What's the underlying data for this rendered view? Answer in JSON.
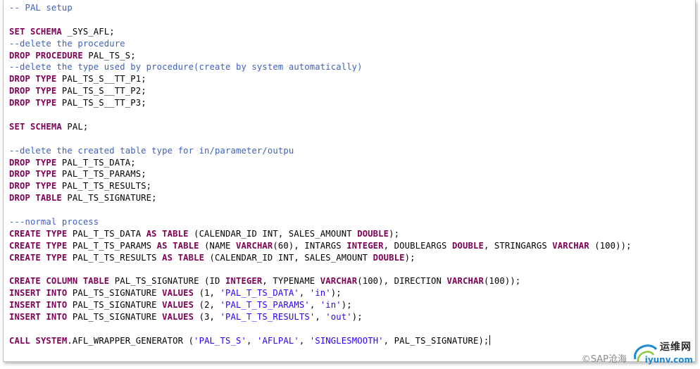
{
  "editor": {
    "lines": [
      {
        "tokens": [
          {
            "t": "-- PAL setup",
            "c": "cm"
          }
        ]
      },
      {
        "tokens": []
      },
      {
        "tokens": [
          {
            "t": "SET SCHEMA",
            "c": "kw"
          },
          {
            "t": " _SYS_AFL;",
            "c": ""
          }
        ]
      },
      {
        "tokens": [
          {
            "t": "--delete the procedure",
            "c": "cm"
          }
        ]
      },
      {
        "tokens": [
          {
            "t": "DROP PROCEDURE",
            "c": "kw"
          },
          {
            "t": " PAL_TS_S;",
            "c": ""
          }
        ]
      },
      {
        "tokens": [
          {
            "t": "--delete the type used by procedure(create by system automatically)",
            "c": "cm"
          }
        ]
      },
      {
        "tokens": [
          {
            "t": "DROP TYPE",
            "c": "kw"
          },
          {
            "t": " PAL_TS_S__TT_P1;",
            "c": ""
          }
        ]
      },
      {
        "tokens": [
          {
            "t": "DROP TYPE",
            "c": "kw"
          },
          {
            "t": " PAL_TS_S__TT_P2;",
            "c": ""
          }
        ]
      },
      {
        "tokens": [
          {
            "t": "DROP TYPE",
            "c": "kw"
          },
          {
            "t": " PAL_TS_S__TT_P3;",
            "c": ""
          }
        ]
      },
      {
        "tokens": []
      },
      {
        "tokens": [
          {
            "t": "SET SCHEMA",
            "c": "kw"
          },
          {
            "t": " PAL;",
            "c": ""
          }
        ]
      },
      {
        "tokens": []
      },
      {
        "tokens": [
          {
            "t": "--delete the created table type for in/parameter/outpu",
            "c": "cm"
          }
        ]
      },
      {
        "tokens": [
          {
            "t": "DROP TYPE",
            "c": "kw"
          },
          {
            "t": " PAL_T_TS_DATA;",
            "c": ""
          }
        ]
      },
      {
        "tokens": [
          {
            "t": "DROP TYPE",
            "c": "kw"
          },
          {
            "t": " PAL_T_TS_PARAMS;",
            "c": ""
          }
        ]
      },
      {
        "tokens": [
          {
            "t": "DROP TYPE",
            "c": "kw"
          },
          {
            "t": " PAL_T_TS_RESULTS;",
            "c": ""
          }
        ]
      },
      {
        "tokens": [
          {
            "t": "DROP TABLE",
            "c": "kw"
          },
          {
            "t": " PAL_TS_SIGNATURE;",
            "c": ""
          }
        ]
      },
      {
        "tokens": []
      },
      {
        "tokens": [
          {
            "t": "---normal process",
            "c": "cm"
          }
        ]
      },
      {
        "tokens": [
          {
            "t": "CREATE TYPE",
            "c": "kw"
          },
          {
            "t": " PAL_T_TS_DATA ",
            "c": ""
          },
          {
            "t": "AS TABLE",
            "c": "kw"
          },
          {
            "t": " (CALENDAR_ID INT, SALES_AMOUNT ",
            "c": ""
          },
          {
            "t": "DOUBLE",
            "c": "kw"
          },
          {
            "t": ");",
            "c": ""
          }
        ]
      },
      {
        "tokens": [
          {
            "t": "CREATE TYPE",
            "c": "kw"
          },
          {
            "t": " PAL_T_TS_PARAMS ",
            "c": ""
          },
          {
            "t": "AS TABLE",
            "c": "kw"
          },
          {
            "t": " (NAME ",
            "c": ""
          },
          {
            "t": "VARCHAR",
            "c": "kw"
          },
          {
            "t": "(60), INTARGS ",
            "c": ""
          },
          {
            "t": "INTEGER",
            "c": "kw"
          },
          {
            "t": ", DOUBLEARGS ",
            "c": ""
          },
          {
            "t": "DOUBLE",
            "c": "kw"
          },
          {
            "t": ", STRINGARGS ",
            "c": ""
          },
          {
            "t": "VARCHAR",
            "c": "kw"
          },
          {
            "t": " (100));",
            "c": ""
          }
        ]
      },
      {
        "tokens": [
          {
            "t": "CREATE TYPE",
            "c": "kw"
          },
          {
            "t": " PAL_T_TS_RESULTS ",
            "c": ""
          },
          {
            "t": "AS TABLE",
            "c": "kw"
          },
          {
            "t": " (CALENDAR_ID INT, SALES_AMOUNT ",
            "c": ""
          },
          {
            "t": "DOUBLE",
            "c": "kw"
          },
          {
            "t": ");",
            "c": ""
          }
        ]
      },
      {
        "tokens": []
      },
      {
        "tokens": [
          {
            "t": "CREATE COLUMN TABLE",
            "c": "kw"
          },
          {
            "t": " PAL_TS_SIGNATURE (ID ",
            "c": ""
          },
          {
            "t": "INTEGER",
            "c": "kw"
          },
          {
            "t": ", TYPENAME ",
            "c": ""
          },
          {
            "t": "VARCHAR",
            "c": "kw"
          },
          {
            "t": "(100), DIRECTION ",
            "c": ""
          },
          {
            "t": "VARCHAR",
            "c": "kw"
          },
          {
            "t": "(100));",
            "c": ""
          }
        ]
      },
      {
        "tokens": [
          {
            "t": "INSERT INTO",
            "c": "kw"
          },
          {
            "t": " PAL_TS_SIGNATURE ",
            "c": ""
          },
          {
            "t": "VALUES",
            "c": "kw"
          },
          {
            "t": " (1, ",
            "c": ""
          },
          {
            "t": "'PAL_T_TS_DATA'",
            "c": "str"
          },
          {
            "t": ", ",
            "c": ""
          },
          {
            "t": "'in'",
            "c": "str"
          },
          {
            "t": ");",
            "c": ""
          }
        ]
      },
      {
        "tokens": [
          {
            "t": "INSERT INTO",
            "c": "kw"
          },
          {
            "t": " PAL_TS_SIGNATURE ",
            "c": ""
          },
          {
            "t": "VALUES",
            "c": "kw"
          },
          {
            "t": " (2, ",
            "c": ""
          },
          {
            "t": "'PAL_T_TS_PARAMS'",
            "c": "str"
          },
          {
            "t": ", ",
            "c": ""
          },
          {
            "t": "'in'",
            "c": "str"
          },
          {
            "t": ");",
            "c": ""
          }
        ]
      },
      {
        "tokens": [
          {
            "t": "INSERT INTO",
            "c": "kw"
          },
          {
            "t": " PAL_TS_SIGNATURE ",
            "c": ""
          },
          {
            "t": "VALUES",
            "c": "kw"
          },
          {
            "t": " (3, ",
            "c": ""
          },
          {
            "t": "'PAL_T_TS_RESULTS'",
            "c": "str"
          },
          {
            "t": ", ",
            "c": ""
          },
          {
            "t": "'out'",
            "c": "str"
          },
          {
            "t": ");",
            "c": ""
          }
        ]
      },
      {
        "tokens": []
      },
      {
        "tokens": [
          {
            "t": "CALL",
            "c": "kw"
          },
          {
            "t": " ",
            "c": ""
          },
          {
            "t": "SYSTEM",
            "c": "kw"
          },
          {
            "t": ".AFL_WRAPPER_GENERATOR (",
            "c": ""
          },
          {
            "t": "'PAL_TS_S'",
            "c": "str"
          },
          {
            "t": ", ",
            "c": ""
          },
          {
            "t": "'AFLPAL'",
            "c": "str"
          },
          {
            "t": ", ",
            "c": ""
          },
          {
            "t": "'SINGLESMOOTH'",
            "c": "str"
          },
          {
            "t": ", PAL_TS_SIGNATURE);",
            "c": ""
          }
        ],
        "cursor": true
      }
    ]
  },
  "watermark": {
    "credit": "©SAP沧海",
    "brand_cn": "运维网",
    "brand_url": "iyunv.com",
    "logo_icon": "swirl-logo-icon"
  },
  "colors": {
    "keyword": "#7f0055",
    "comment": "#3f5fbf",
    "string": "#2a00ff",
    "text": "#000000"
  }
}
